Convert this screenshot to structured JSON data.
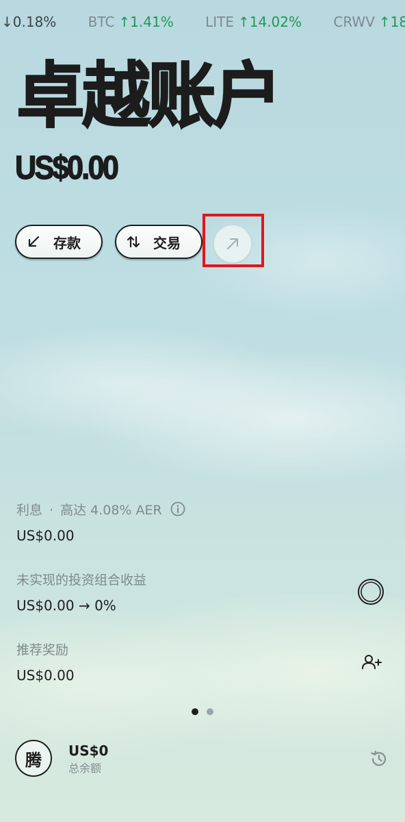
{
  "ticker": [
    {
      "symbol": "",
      "direction": "down",
      "change": "0.18%"
    },
    {
      "symbol": "BTC",
      "direction": "up",
      "change": "1.41%"
    },
    {
      "symbol": "LITE",
      "direction": "up",
      "change": "14.02%"
    },
    {
      "symbol": "CRWV",
      "direction": "up",
      "change": "18"
    }
  ],
  "header": {
    "title": "卓越账户",
    "balance": "US$0.00"
  },
  "actions": {
    "deposit_label": "存款",
    "trade_label": "交易"
  },
  "stats": {
    "interest": {
      "label": "利息",
      "separator": "·",
      "rate_text": "高达 4.08% AER",
      "value": "US$0.00"
    },
    "unrealized": {
      "label": "未实现的投资组合收益",
      "value": "US$0.00 → 0%"
    },
    "referral": {
      "label": "推荐奖励",
      "value": "US$0.00"
    }
  },
  "pager": {
    "active_index": 0,
    "count": 2
  },
  "footer": {
    "avatar_char": "腾",
    "total_amount": "US$0",
    "total_label": "总余额"
  },
  "colors": {
    "up": "#1d9a55",
    "highlight": "#e0161b"
  }
}
